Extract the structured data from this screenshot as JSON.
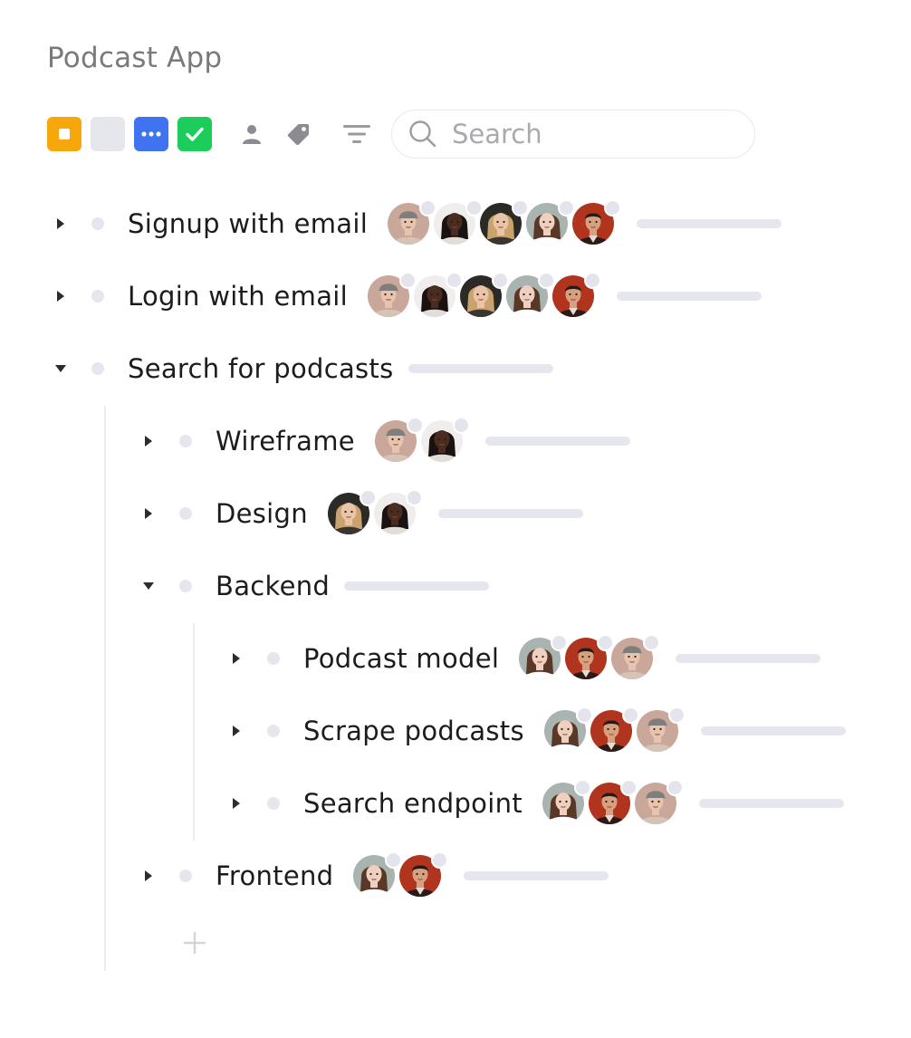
{
  "app": {
    "title": "Podcast App"
  },
  "toolbar": {
    "status_chips": [
      {
        "name": "todo-status",
        "icon": "square-icon",
        "color": "#f5a70b"
      },
      {
        "name": "empty-status",
        "icon": "",
        "color": "#e6e6ed"
      },
      {
        "name": "in-progress-status",
        "icon": "ellipsis-icon",
        "color": "#3f73f0"
      },
      {
        "name": "done-status",
        "icon": "check-icon",
        "color": "#1ccd5c"
      }
    ],
    "tools": [
      {
        "name": "assignee-filter",
        "icon": "person-icon"
      },
      {
        "name": "tag-filter",
        "icon": "tag-icon"
      },
      {
        "name": "sort-filter",
        "icon": "filter-icon"
      }
    ],
    "search": {
      "placeholder": "Search",
      "value": ""
    }
  },
  "colors": {
    "accent_blue": "#3f73f0",
    "accent_green": "#1ccd5c",
    "accent_orange": "#f5a70b",
    "muted": "#e6e6ee"
  },
  "tree": [
    {
      "title": "Signup with email",
      "expanded": false,
      "depth": 0,
      "avatars": [
        "man-cap",
        "woman-dark",
        "woman-blonde",
        "woman-brunette",
        "man-red"
      ]
    },
    {
      "title": "Login with email",
      "expanded": false,
      "depth": 0,
      "avatars": [
        "man-cap",
        "woman-dark",
        "woman-blonde",
        "woman-brunette",
        "man-red"
      ]
    },
    {
      "title": "Search for podcasts",
      "expanded": true,
      "depth": 0,
      "avatars": []
    },
    {
      "title": "Wireframe",
      "expanded": false,
      "depth": 1,
      "avatars": [
        "man-cap",
        "woman-dark"
      ]
    },
    {
      "title": "Design",
      "expanded": false,
      "depth": 1,
      "avatars": [
        "woman-blonde",
        "woman-dark"
      ]
    },
    {
      "title": "Backend",
      "expanded": true,
      "depth": 1,
      "avatars": []
    },
    {
      "title": "Podcast model",
      "expanded": false,
      "depth": 2,
      "avatars": [
        "woman-brunette",
        "man-red",
        "man-cap"
      ]
    },
    {
      "title": "Scrape podcasts",
      "expanded": false,
      "depth": 2,
      "avatars": [
        "woman-brunette",
        "man-red",
        "man-cap"
      ]
    },
    {
      "title": "Search endpoint",
      "expanded": false,
      "depth": 2,
      "avatars": [
        "woman-brunette",
        "man-red",
        "man-cap"
      ]
    },
    {
      "title": "Frontend",
      "expanded": false,
      "depth": 1,
      "avatars": [
        "woman-brunette",
        "man-red"
      ]
    }
  ],
  "add_item": {
    "icon": "plus-icon"
  }
}
